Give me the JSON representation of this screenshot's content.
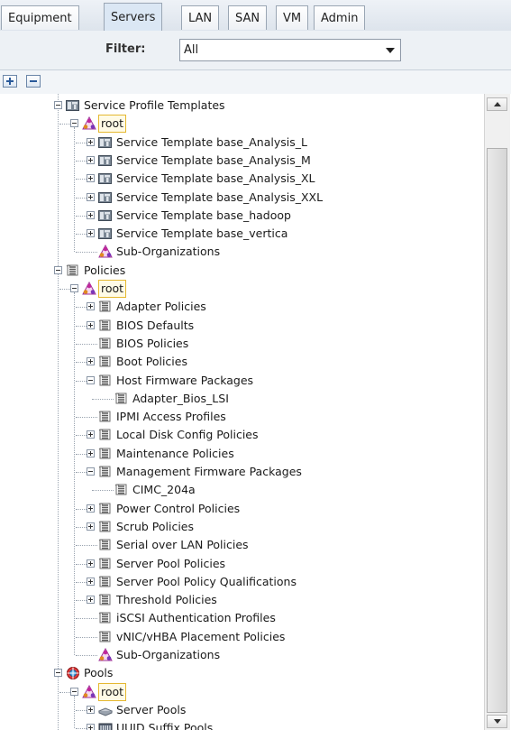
{
  "tabs": [
    {
      "label": "Equipment",
      "active": false
    },
    {
      "label": "Servers",
      "active": true
    },
    {
      "label": "LAN",
      "active": false
    },
    {
      "label": "SAN",
      "active": false
    },
    {
      "label": "VM",
      "active": false
    },
    {
      "label": "Admin",
      "active": false
    }
  ],
  "filter": {
    "label": "Filter:",
    "value": "All"
  },
  "tree": [
    {
      "text": "Service Profile Templates",
      "depth": 0,
      "expander": "minus",
      "icon": "template-icon"
    },
    {
      "text": "root",
      "depth": 1,
      "expander": "minus",
      "icon": "org-icon",
      "selected": true
    },
    {
      "text": "Service Template base_Analysis_L",
      "depth": 2,
      "expander": "plus",
      "icon": "template-icon"
    },
    {
      "text": "Service Template base_Analysis_M",
      "depth": 2,
      "expander": "plus",
      "icon": "template-icon"
    },
    {
      "text": "Service Template base_Analysis_XL",
      "depth": 2,
      "expander": "plus",
      "icon": "template-icon"
    },
    {
      "text": "Service Template base_Analysis_XXL",
      "depth": 2,
      "expander": "plus",
      "icon": "template-icon"
    },
    {
      "text": "Service Template base_hadoop",
      "depth": 2,
      "expander": "plus",
      "icon": "template-icon"
    },
    {
      "text": "Service Template base_vertica",
      "depth": 2,
      "expander": "plus",
      "icon": "template-icon"
    },
    {
      "text": "Sub-Organizations",
      "depth": 2,
      "expander": "none",
      "icon": "org-icon"
    },
    {
      "text": "Policies",
      "depth": 0,
      "expander": "minus",
      "icon": "policy-icon"
    },
    {
      "text": "root",
      "depth": 1,
      "expander": "minus",
      "icon": "org-icon",
      "selected": true
    },
    {
      "text": "Adapter Policies",
      "depth": 2,
      "expander": "plus",
      "icon": "policy-icon"
    },
    {
      "text": "BIOS Defaults",
      "depth": 2,
      "expander": "plus",
      "icon": "policy-icon"
    },
    {
      "text": "BIOS Policies",
      "depth": 2,
      "expander": "none",
      "icon": "policy-icon"
    },
    {
      "text": "Boot Policies",
      "depth": 2,
      "expander": "plus",
      "icon": "policy-icon"
    },
    {
      "text": "Host Firmware Packages",
      "depth": 2,
      "expander": "minus",
      "icon": "policy-icon"
    },
    {
      "text": "Adapter_Bios_LSI",
      "depth": 3,
      "expander": "none",
      "icon": "policy-icon"
    },
    {
      "text": "IPMI Access Profiles",
      "depth": 2,
      "expander": "none",
      "icon": "policy-icon"
    },
    {
      "text": "Local Disk Config Policies",
      "depth": 2,
      "expander": "plus",
      "icon": "policy-icon"
    },
    {
      "text": "Maintenance Policies",
      "depth": 2,
      "expander": "plus",
      "icon": "policy-icon"
    },
    {
      "text": "Management Firmware Packages",
      "depth": 2,
      "expander": "minus",
      "icon": "policy-icon"
    },
    {
      "text": "CIMC_204a",
      "depth": 3,
      "expander": "none",
      "icon": "policy-icon"
    },
    {
      "text": "Power Control Policies",
      "depth": 2,
      "expander": "plus",
      "icon": "policy-icon"
    },
    {
      "text": "Scrub Policies",
      "depth": 2,
      "expander": "plus",
      "icon": "policy-icon"
    },
    {
      "text": "Serial over LAN Policies",
      "depth": 2,
      "expander": "none",
      "icon": "policy-icon"
    },
    {
      "text": "Server Pool Policies",
      "depth": 2,
      "expander": "plus",
      "icon": "policy-icon"
    },
    {
      "text": "Server Pool Policy Qualifications",
      "depth": 2,
      "expander": "plus",
      "icon": "policy-icon"
    },
    {
      "text": "Threshold Policies",
      "depth": 2,
      "expander": "plus",
      "icon": "policy-icon"
    },
    {
      "text": "iSCSI Authentication Profiles",
      "depth": 2,
      "expander": "none",
      "icon": "policy-icon"
    },
    {
      "text": "vNIC/vHBA Placement Policies",
      "depth": 2,
      "expander": "none",
      "icon": "policy-icon"
    },
    {
      "text": "Sub-Organizations",
      "depth": 2,
      "expander": "none",
      "icon": "org-icon"
    },
    {
      "text": "Pools",
      "depth": 0,
      "expander": "minus",
      "icon": "pool-icon"
    },
    {
      "text": "root",
      "depth": 1,
      "expander": "minus",
      "icon": "org-icon",
      "selected": true
    },
    {
      "text": "Server Pools",
      "depth": 2,
      "expander": "plus",
      "icon": "server-pool-icon"
    },
    {
      "text": "UUID Suffix Pools",
      "depth": 2,
      "expander": "plus",
      "icon": "uuid-pool-icon"
    }
  ]
}
